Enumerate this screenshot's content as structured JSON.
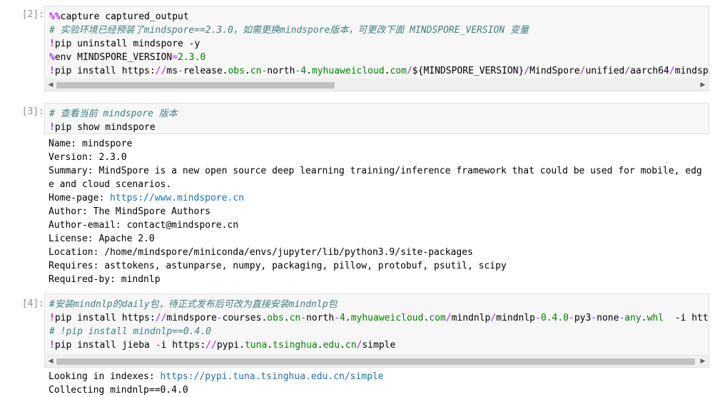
{
  "cells": [
    {
      "prompt": "[2]:",
      "lines": [
        [
          {
            "t": "%%",
            "c": "mg"
          },
          {
            "t": "capture captured_output",
            "c": ""
          }
        ],
        [
          {
            "t": "# 实验环境已经预装了mindspore==2.3.0，如需更换mindspore版本，可更改下面 MINDSPORE_VERSION 变量",
            "c": "cm"
          }
        ],
        [
          {
            "t": "!",
            "c": "bang"
          },
          {
            "t": "pip uninstall mindspore -y",
            "c": ""
          }
        ],
        [
          {
            "t": "%",
            "c": "mg"
          },
          {
            "t": "env MINDSPORE_VERSION",
            "c": ""
          },
          {
            "t": "=",
            "c": "op"
          },
          {
            "t": "2.3.0",
            "c": "num"
          }
        ],
        [
          {
            "t": "!",
            "c": "bang"
          },
          {
            "t": "pip install https:",
            "c": ""
          },
          {
            "t": "//",
            "c": "op"
          },
          {
            "t": "ms",
            "c": ""
          },
          {
            "t": "-",
            "c": "op"
          },
          {
            "t": "release.",
            "c": ""
          },
          {
            "t": "obs",
            "c": "url-seg"
          },
          {
            "t": ".",
            "c": ""
          },
          {
            "t": "cn",
            "c": "url-seg"
          },
          {
            "t": "-",
            "c": "op"
          },
          {
            "t": "north",
            "c": ""
          },
          {
            "t": "-",
            "c": "op"
          },
          {
            "t": "4",
            "c": "num"
          },
          {
            "t": ".",
            "c": ""
          },
          {
            "t": "myhuaweicloud",
            "c": "url-seg"
          },
          {
            "t": ".",
            "c": ""
          },
          {
            "t": "com",
            "c": "url-seg"
          },
          {
            "t": "/",
            "c": "op"
          },
          {
            "t": "$",
            "c": ""
          },
          {
            "t": "{MINDSPORE_VERSION}",
            "c": ""
          },
          {
            "t": "/",
            "c": "op"
          },
          {
            "t": "MindSpore",
            "c": ""
          },
          {
            "t": "/",
            "c": "op"
          },
          {
            "t": "unified",
            "c": ""
          },
          {
            "t": "/",
            "c": "op"
          },
          {
            "t": "aarch64",
            "c": ""
          },
          {
            "t": "/",
            "c": "op"
          },
          {
            "t": "mindspore-",
            "c": ""
          }
        ]
      ]
    },
    {
      "prompt": "[3]:",
      "lines": [
        [
          {
            "t": "# 查看当前 mindspore 版本",
            "c": "cm"
          }
        ],
        [
          {
            "t": "!",
            "c": "bang"
          },
          {
            "t": "pip show mindspore",
            "c": ""
          }
        ]
      ],
      "output_segments": [
        [
          {
            "t": "Name: mindspore"
          }
        ],
        [
          {
            "t": "Version: 2.3.0"
          }
        ],
        [
          {
            "t": "Summary: MindSpore is a new open source deep learning training/inference framework that could be used for mobile, edg"
          }
        ],
        [
          {
            "t": "e and cloud scenarios."
          }
        ],
        [
          {
            "t": "Home-page: "
          },
          {
            "t": "https://www.mindspore.cn",
            "link": true
          }
        ],
        [
          {
            "t": "Author: The MindSpore Authors"
          }
        ],
        [
          {
            "t": "Author-email: contact@mindspore.cn"
          }
        ],
        [
          {
            "t": "License: Apache 2.0"
          }
        ],
        [
          {
            "t": "Location: /home/mindspore/miniconda/envs/jupyter/lib/python3.9/site-packages"
          }
        ],
        [
          {
            "t": "Requires: asttokens, astunparse, numpy, packaging, pillow, protobuf, psutil, scipy"
          }
        ],
        [
          {
            "t": "Required-by: mindnlp"
          }
        ]
      ]
    },
    {
      "prompt": "[4]:",
      "lines": [
        [
          {
            "t": "#安装mindnlp的daily包，待正式发布后可改为直接安装mindnlp包",
            "c": "cm"
          }
        ],
        [
          {
            "t": "!",
            "c": "bang"
          },
          {
            "t": "pip install https:",
            "c": ""
          },
          {
            "t": "//",
            "c": "op"
          },
          {
            "t": "mindspore",
            "c": ""
          },
          {
            "t": "-",
            "c": "op"
          },
          {
            "t": "courses.",
            "c": ""
          },
          {
            "t": "obs",
            "c": "url-seg"
          },
          {
            "t": ".",
            "c": ""
          },
          {
            "t": "cn",
            "c": "url-seg"
          },
          {
            "t": "-",
            "c": "op"
          },
          {
            "t": "north",
            "c": ""
          },
          {
            "t": "-",
            "c": "op"
          },
          {
            "t": "4",
            "c": "num"
          },
          {
            "t": ".",
            "c": ""
          },
          {
            "t": "myhuaweicloud",
            "c": "url-seg"
          },
          {
            "t": ".",
            "c": ""
          },
          {
            "t": "com",
            "c": "url-seg"
          },
          {
            "t": "/",
            "c": "op"
          },
          {
            "t": "mindnlp",
            "c": ""
          },
          {
            "t": "/",
            "c": "op"
          },
          {
            "t": "mindnlp",
            "c": ""
          },
          {
            "t": "-",
            "c": "op"
          },
          {
            "t": "0.4.0",
            "c": "num"
          },
          {
            "t": "-",
            "c": "op"
          },
          {
            "t": "py3",
            "c": ""
          },
          {
            "t": "-",
            "c": "op"
          },
          {
            "t": "none",
            "c": ""
          },
          {
            "t": "-",
            "c": "op"
          },
          {
            "t": "any",
            "c": "kw"
          },
          {
            "t": ".",
            "c": ""
          },
          {
            "t": "whl",
            "c": "url-seg"
          },
          {
            "t": "  -i htt",
            "c": ""
          }
        ],
        [
          {
            "t": "# !pip install mindnlp==0.4.0",
            "c": "cm"
          }
        ],
        [
          {
            "t": "!",
            "c": "bang"
          },
          {
            "t": "pip install jieba ",
            "c": ""
          },
          {
            "t": "-",
            "c": "op"
          },
          {
            "t": "i https:",
            "c": ""
          },
          {
            "t": "//",
            "c": "op"
          },
          {
            "t": "pypi.",
            "c": ""
          },
          {
            "t": "tuna",
            "c": "url-seg"
          },
          {
            "t": ".",
            "c": ""
          },
          {
            "t": "tsinghua",
            "c": "url-seg"
          },
          {
            "t": ".",
            "c": ""
          },
          {
            "t": "edu",
            "c": "url-seg"
          },
          {
            "t": ".",
            "c": ""
          },
          {
            "t": "cn",
            "c": "url-seg"
          },
          {
            "t": "/",
            "c": "op"
          },
          {
            "t": "simple",
            "c": ""
          }
        ]
      ],
      "output_segments": [
        [
          {
            "t": "Looking in indexes: "
          },
          {
            "t": "https://pypi.tuna.tsinghua.edu.cn/simple",
            "link": true
          }
        ],
        [
          {
            "t": "Collecting mindnlp==0.4.0"
          }
        ]
      ]
    }
  ],
  "colors": {
    "comment": "#408080",
    "magic": "#aa22ff",
    "link": "#1a6fb5",
    "prompt": "#909090"
  },
  "icons": {
    "scroll_left": "triangle-left-icon",
    "scroll_right": "triangle-right-icon"
  }
}
